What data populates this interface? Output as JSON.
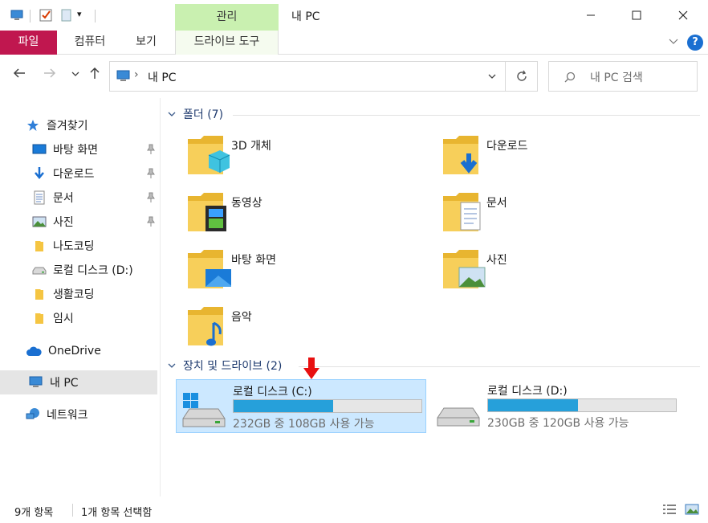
{
  "window": {
    "title": "내 PC"
  },
  "ribbon": {
    "context_group": "관리",
    "tabs": [
      "파일",
      "컴퓨터",
      "보기",
      "드라이브 도구"
    ]
  },
  "address": {
    "path_label": "내 PC",
    "separator": "›"
  },
  "search": {
    "placeholder": "내 PC 검색"
  },
  "navpane": {
    "quick_access": "즐겨찾기",
    "quick_items": [
      {
        "label": "바탕 화면",
        "icon": "desktop-icon",
        "pinned": true
      },
      {
        "label": "다운로드",
        "icon": "download-icon",
        "pinned": true
      },
      {
        "label": "문서",
        "icon": "document-icon",
        "pinned": true
      },
      {
        "label": "사진",
        "icon": "pictures-icon",
        "pinned": true
      },
      {
        "label": "나도코딩",
        "icon": "folder-icon",
        "pinned": false
      },
      {
        "label": "로컬 디스크 (D:)",
        "icon": "drive-icon",
        "pinned": false
      },
      {
        "label": "생활코딩",
        "icon": "folder-icon",
        "pinned": false
      },
      {
        "label": "임시",
        "icon": "folder-icon",
        "pinned": false
      }
    ],
    "onedrive": "OneDrive",
    "this_pc": "내 PC",
    "network": "네트워크"
  },
  "content": {
    "folders_header": "폴더 (7)",
    "folders": [
      {
        "label": "3D 개체",
        "icon": "3d-objects-icon"
      },
      {
        "label": "다운로드",
        "icon": "downloads-folder-icon"
      },
      {
        "label": "동영상",
        "icon": "videos-folder-icon"
      },
      {
        "label": "문서",
        "icon": "documents-folder-icon"
      },
      {
        "label": "바탕 화면",
        "icon": "desktop-folder-icon"
      },
      {
        "label": "사진",
        "icon": "pictures-folder-icon"
      },
      {
        "label": "음악",
        "icon": "music-folder-icon"
      }
    ],
    "drives_header": "장치 및 드라이브 (2)",
    "drives": [
      {
        "name": "로컬 디스크 (C:)",
        "free_text": "232GB 중 108GB 사용 가능",
        "used_fraction": 0.53,
        "selected": true
      },
      {
        "name": "로컬 디스크 (D:)",
        "free_text": "230GB 중 120GB 사용 가능",
        "used_fraction": 0.48,
        "selected": false
      }
    ]
  },
  "status": {
    "item_count": "9개 항목",
    "selected_count": "1개 항목 선택함"
  },
  "colors": {
    "file_tab": "#c0174f",
    "context_tab": "#c9f0b0",
    "selection": "#cce8ff",
    "drive_bar": "#26a0da",
    "folder": "#f5c542",
    "annotation_arrow": "#e81010"
  }
}
